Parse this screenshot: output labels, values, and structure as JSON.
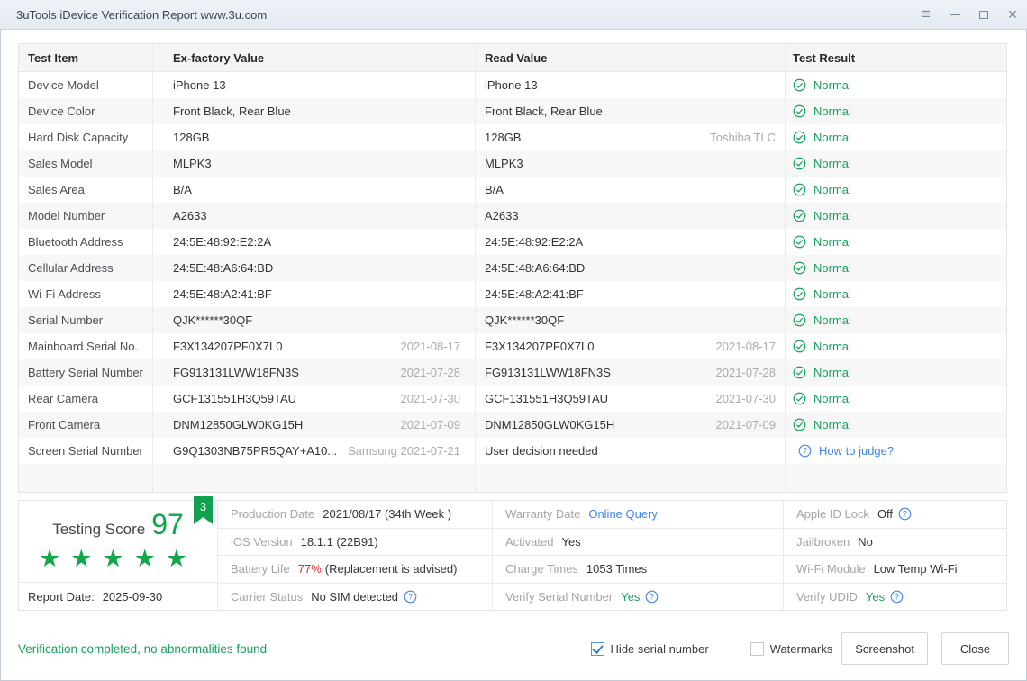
{
  "window": {
    "title": "3uTools iDevice Verification Report www.3u.com",
    "control_icons": [
      "menu-icon",
      "minimize-icon",
      "restore-icon",
      "close-icon"
    ]
  },
  "colors": {
    "accent_green": "#18a05c",
    "star_green": "#12a74b",
    "link_blue": "#4285e8",
    "alert_red": "#e12a2a"
  },
  "icons": {
    "result_ok": "check-circle-icon",
    "help": "question-circle-icon",
    "score_flag": "ribbon-badge-icon",
    "star": "star-icon"
  },
  "table": {
    "headers": [
      "Test Item",
      "Ex-factory Value",
      "Read Value",
      "Test Result"
    ],
    "rows": [
      {
        "item": "Device Model",
        "factory": "iPhone 13",
        "factory_note": "",
        "read": "iPhone 13",
        "read_note": "",
        "result": {
          "type": "normal",
          "label": "Normal"
        }
      },
      {
        "item": "Device Color",
        "factory": "Front Black,  Rear Blue",
        "factory_note": "",
        "read": "Front Black,  Rear Blue",
        "read_note": "",
        "result": {
          "type": "normal",
          "label": "Normal"
        }
      },
      {
        "item": "Hard Disk Capacity",
        "factory": "128GB",
        "factory_note": "",
        "read": "128GB",
        "read_note": "Toshiba TLC",
        "result": {
          "type": "normal",
          "label": "Normal"
        }
      },
      {
        "item": "Sales Model",
        "factory": "MLPK3",
        "factory_note": "",
        "read": "MLPK3",
        "read_note": "",
        "result": {
          "type": "normal",
          "label": "Normal"
        }
      },
      {
        "item": "Sales Area",
        "factory": "B/A",
        "factory_note": "",
        "read": "B/A",
        "read_note": "",
        "result": {
          "type": "normal",
          "label": "Normal"
        }
      },
      {
        "item": "Model Number",
        "factory": "A2633",
        "factory_note": "",
        "read": "A2633",
        "read_note": "",
        "result": {
          "type": "normal",
          "label": "Normal"
        }
      },
      {
        "item": "Bluetooth Address",
        "factory": "24:5E:48:92:E2:2A",
        "factory_note": "",
        "read": "24:5E:48:92:E2:2A",
        "read_note": "",
        "result": {
          "type": "normal",
          "label": "Normal"
        }
      },
      {
        "item": "Cellular Address",
        "factory": "24:5E:48:A6:64:BD",
        "factory_note": "",
        "read": "24:5E:48:A6:64:BD",
        "read_note": "",
        "result": {
          "type": "normal",
          "label": "Normal"
        }
      },
      {
        "item": "Wi-Fi Address",
        "factory": "24:5E:48:A2:41:BF",
        "factory_note": "",
        "read": "24:5E:48:A2:41:BF",
        "read_note": "",
        "result": {
          "type": "normal",
          "label": "Normal"
        }
      },
      {
        "item": "Serial Number",
        "factory": "QJK******30QF",
        "factory_note": "",
        "read": "QJK******30QF",
        "read_note": "",
        "result": {
          "type": "normal",
          "label": "Normal"
        }
      },
      {
        "item": "Mainboard Serial No.",
        "factory": "F3X134207PF0X7L0",
        "factory_note": "2021-08-17",
        "read": "F3X134207PF0X7L0",
        "read_note": "2021-08-17",
        "result": {
          "type": "normal",
          "label": "Normal"
        }
      },
      {
        "item": "Battery Serial Number",
        "factory": "FG913131LWW18FN3S",
        "factory_note": "2021-07-28",
        "read": "FG913131LWW18FN3S",
        "read_note": "2021-07-28",
        "result": {
          "type": "normal",
          "label": "Normal"
        }
      },
      {
        "item": "Rear Camera",
        "factory": "GCF131551H3Q59TAU",
        "factory_note": "2021-07-30",
        "read": "GCF131551H3Q59TAU",
        "read_note": "2021-07-30",
        "result": {
          "type": "normal",
          "label": "Normal"
        }
      },
      {
        "item": "Front Camera",
        "factory": "DNM12850GLW0KG15H",
        "factory_note": "2021-07-09",
        "read": "DNM12850GLW0KG15H",
        "read_note": "2021-07-09",
        "result": {
          "type": "normal",
          "label": "Normal"
        }
      },
      {
        "item": "Screen Serial Number",
        "factory": "G9Q1303NB75PR5QAY+A10...",
        "factory_note": "Samsung 2021-07-21",
        "read": "User decision needed",
        "read_note": "",
        "result": {
          "type": "help-link",
          "label": "How to judge?"
        }
      }
    ]
  },
  "summary": {
    "score": {
      "label": "Testing Score",
      "value": "97",
      "badge": "3",
      "stars": 5
    },
    "report_date_label": "Report Date:",
    "report_date": "2025-09-30",
    "info_columns": [
      [
        {
          "label": "Production Date",
          "value": "2021/08/17 (34th Week )",
          "style": "plain",
          "suffix": "",
          "help": false
        },
        {
          "label": "iOS Version",
          "value": "18.1.1 (22B91)",
          "style": "plain",
          "suffix": "",
          "help": false
        },
        {
          "label": "Battery Life",
          "value": "77%",
          "style": "red",
          "suffix": "(Replacement is advised)",
          "help": false
        },
        {
          "label": "Carrier Status",
          "value": "No SIM detected",
          "style": "plain",
          "suffix": "",
          "help": true
        }
      ],
      [
        {
          "label": "Warranty Date",
          "value": "Online Query",
          "style": "link",
          "suffix": "",
          "help": false
        },
        {
          "label": "Activated",
          "value": "Yes",
          "style": "plain",
          "suffix": "",
          "help": false
        },
        {
          "label": "Charge Times",
          "value": "1053 Times",
          "style": "plain",
          "suffix": "",
          "help": false
        },
        {
          "label": "Verify Serial Number",
          "value": "Yes",
          "style": "green",
          "suffix": "",
          "help": true
        }
      ],
      [
        {
          "label": "Apple ID Lock",
          "value": "Off",
          "style": "plain",
          "suffix": "",
          "help": true
        },
        {
          "label": "Jailbroken",
          "value": "No",
          "style": "plain",
          "suffix": "",
          "help": false
        },
        {
          "label": "Wi-Fi Module",
          "value": "Low Temp Wi-Fi",
          "style": "plain",
          "suffix": "",
          "help": false
        },
        {
          "label": "Verify UDID",
          "value": "Yes",
          "style": "green",
          "suffix": "",
          "help": true
        }
      ]
    ]
  },
  "footer": {
    "status": "Verification completed, no abnormalities found",
    "checkboxes": [
      {
        "label": "Hide serial number",
        "checked": true
      },
      {
        "label": "Watermarks",
        "checked": false
      }
    ],
    "buttons": [
      "Screenshot",
      "Close"
    ]
  }
}
